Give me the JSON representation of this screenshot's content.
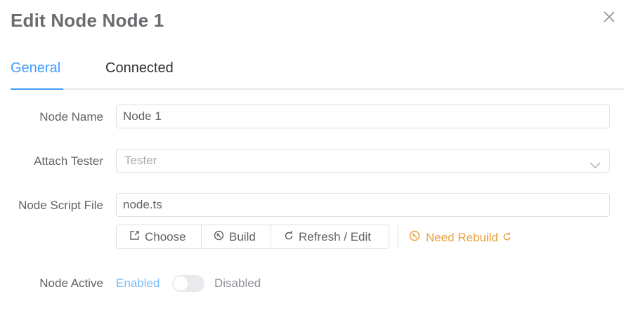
{
  "dialog": {
    "title": "Edit Node Node 1"
  },
  "tabs": [
    {
      "label": "General",
      "active": true
    },
    {
      "label": "Connected",
      "active": false
    }
  ],
  "form": {
    "node_name": {
      "label": "Node Name",
      "value": "Node 1"
    },
    "attach_tester": {
      "label": "Attach Tester",
      "placeholder": "Tester",
      "value": ""
    },
    "node_script_file": {
      "label": "Node Script File",
      "value": "node.ts"
    },
    "script_buttons": {
      "choose": "Choose",
      "build": "Build",
      "refresh_edit": "Refresh / Edit"
    },
    "rebuild_status": "Need Rebuild",
    "node_active": {
      "label": "Node Active",
      "on_text": "Enabled",
      "off_text": "Disabled",
      "value": false
    }
  },
  "colors": {
    "primary": "#409eff",
    "warning": "#e6a23c",
    "border": "#dcdfe6",
    "text": "#606266"
  },
  "icons": [
    "close-icon",
    "chevron-down-icon",
    "choose-file-icon",
    "build-icon",
    "refresh-icon",
    "warning-icon",
    "refresh-small-icon"
  ]
}
